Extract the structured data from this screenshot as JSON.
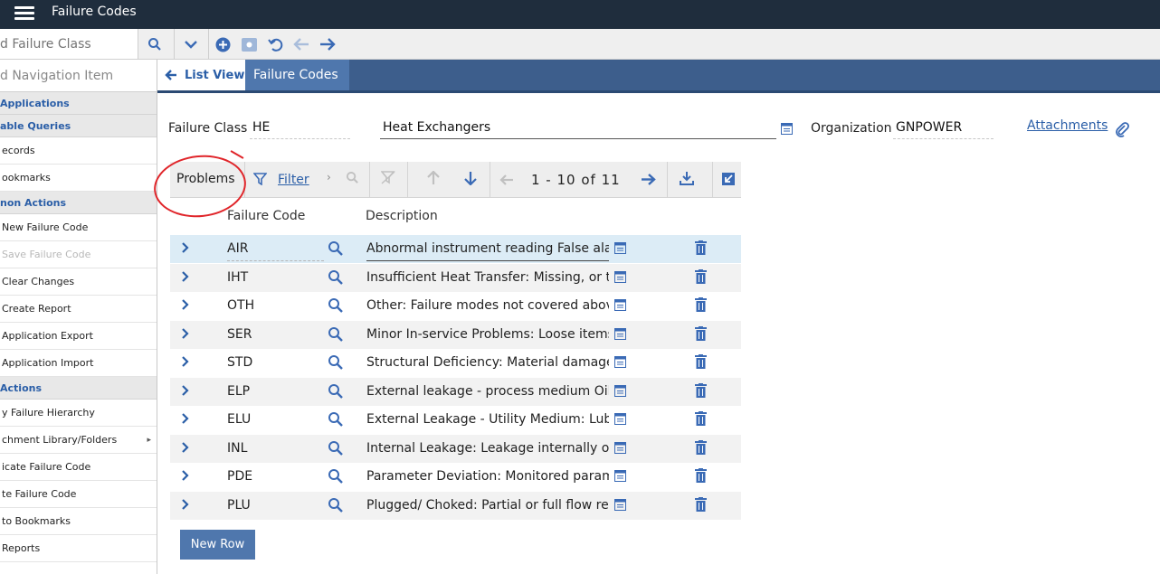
{
  "app": {
    "title": "Failure Codes"
  },
  "toolbar": {
    "search_placeholder": "d Failure Class"
  },
  "sidebar": {
    "nav_input": "d Navigation Item",
    "entries": [
      {
        "type": "section",
        "label": "Applications"
      },
      {
        "type": "section",
        "label": "able Queries"
      },
      {
        "type": "item",
        "label": "ecords"
      },
      {
        "type": "item",
        "label": "ookmarks"
      },
      {
        "type": "section",
        "label": "non Actions"
      },
      {
        "type": "item",
        "label": "New Failure Code"
      },
      {
        "type": "item",
        "label": "Save Failure Code",
        "disabled": true
      },
      {
        "type": "item",
        "label": "Clear Changes"
      },
      {
        "type": "item",
        "label": "Create Report"
      },
      {
        "type": "item",
        "label": "Application Export"
      },
      {
        "type": "item",
        "label": "Application Import"
      },
      {
        "type": "section",
        "label": "Actions"
      },
      {
        "type": "item",
        "label": "y Failure Hierarchy"
      },
      {
        "type": "item",
        "label": "chment Library/Folders",
        "submenu": true
      },
      {
        "type": "item",
        "label": "icate Failure Code"
      },
      {
        "type": "item",
        "label": "te Failure Code"
      },
      {
        "type": "item",
        "label": "to Bookmarks"
      },
      {
        "type": "item",
        "label": "Reports"
      }
    ]
  },
  "breadcrumb": {
    "list_view": "List View",
    "current": "Failure Codes"
  },
  "header": {
    "failure_class_label": "Failure Class",
    "failure_class_value": "HE",
    "description": "Heat Exchangers",
    "organization_label": "Organization",
    "organization_value": "GNPOWER",
    "attachments": "Attachments"
  },
  "table": {
    "title": "Problems",
    "filter_label": "Filter",
    "pagination": "1 - 10 of 11",
    "columns": {
      "code": "Failure Code",
      "description": "Description"
    },
    "rows": [
      {
        "code": "AIR",
        "description": "Abnormal instrument reading False alarm"
      },
      {
        "code": "IHT",
        "description": "Insufficient Heat Transfer: Missing, or t"
      },
      {
        "code": "OTH",
        "description": "Other: Failure modes not covered above"
      },
      {
        "code": "SER",
        "description": "Minor In-service Problems: Loose items"
      },
      {
        "code": "STD",
        "description": "Structural Deficiency: Material damage"
      },
      {
        "code": "ELP",
        "description": "External leakage - process medium Oil,"
      },
      {
        "code": "ELU",
        "description": "External Leakage - Utility Medium: Lub"
      },
      {
        "code": "INL",
        "description": "Internal Leakage: Leakage internally of"
      },
      {
        "code": "PDE",
        "description": "Parameter Deviation: Monitored parame"
      },
      {
        "code": "PLU",
        "description": "Plugged/ Choked: Partial or full flow res"
      }
    ],
    "new_row_label": "New Row"
  }
}
